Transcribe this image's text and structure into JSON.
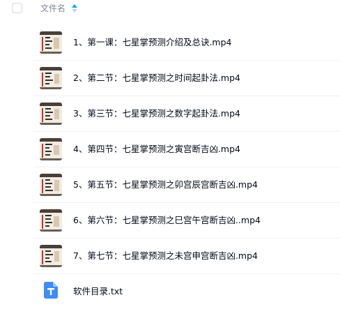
{
  "header": {
    "column_label": "文件名"
  },
  "files": [
    {
      "name": "1、第一课：七星掌预测介绍及总诀.mp4",
      "icon": "video-thumbnail-icon"
    },
    {
      "name": "2、第二节：七星掌预测之时间起卦法.mp4",
      "icon": "video-thumbnail-icon"
    },
    {
      "name": "3、第三节：七星掌预测之数字起卦法.mp4",
      "icon": "video-thumbnail-icon"
    },
    {
      "name": "4、第四节：七星掌预测之寅宫断吉凶.mp4",
      "icon": "video-thumbnail-icon"
    },
    {
      "name": "5、第五节：七星掌预测之卯宫辰宫断吉凶.mp4",
      "icon": "video-thumbnail-icon"
    },
    {
      "name": "6、第六节：七星掌预测之巳宫午宫断吉凶..mp4",
      "icon": "video-thumbnail-icon"
    },
    {
      "name": "7、第七节：七星掌预测之未宫申宫断吉凶.mp4",
      "icon": "video-thumbnail-icon"
    },
    {
      "name": "软件目录.txt",
      "icon": "txt-file-icon"
    }
  ],
  "colors": {
    "text": "#03081a",
    "header_text": "#818999",
    "sort_active": "#06a7ff",
    "txt_icon": "#3d8cf7"
  }
}
